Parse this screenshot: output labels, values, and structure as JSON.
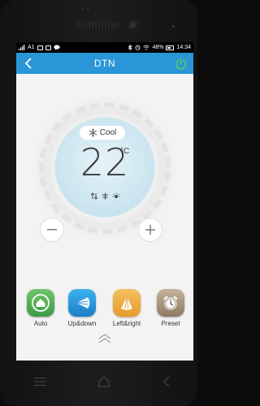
{
  "status_bar": {
    "carrier_left": "A1",
    "battery_percent": "48%",
    "time": "14:34"
  },
  "app_bar": {
    "title": "DTN"
  },
  "dial": {
    "mode_label": "Cool",
    "temperature": "22",
    "unit": "°C"
  },
  "modes": [
    {
      "label": "Auto",
      "color": "#4caf50"
    },
    {
      "label": "Up&down",
      "color": "#2196d8"
    },
    {
      "label": "Left&right",
      "color": "#eea53a"
    },
    {
      "label": "Preset",
      "color": "#a08c73"
    }
  ],
  "colors": {
    "accent": "#2a96d8",
    "power_icon": "#55d05a"
  }
}
